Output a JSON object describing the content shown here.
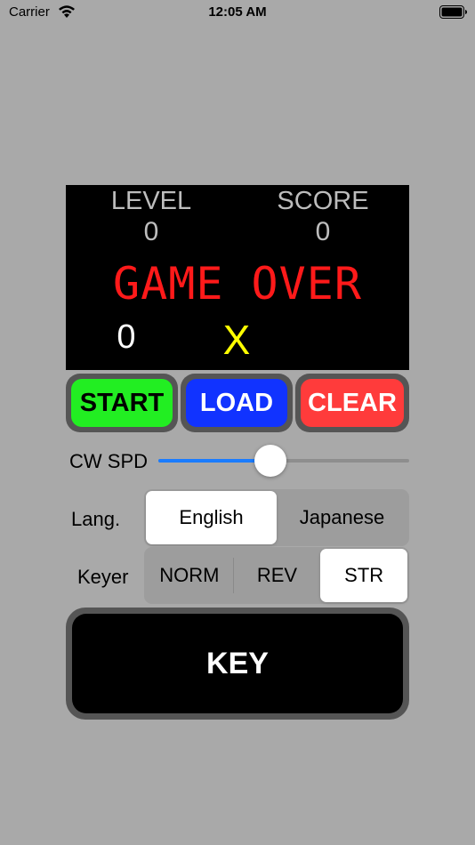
{
  "status_bar": {
    "carrier": "Carrier",
    "time": "12:05 AM"
  },
  "display": {
    "level_label": "LEVEL",
    "level_value": "0",
    "score_label": "SCORE",
    "score_value": "0",
    "message": "GAME OVER",
    "count": "0",
    "character": "X",
    "message_color": "#ff1a1a",
    "character_color": "#ffff00"
  },
  "buttons": {
    "start": "START",
    "load": "LOAD",
    "clear": "CLEAR",
    "start_color": "#22ee22",
    "load_color": "#1133ff",
    "clear_color": "#ff3b3b"
  },
  "cw_speed": {
    "label": "CW SPD",
    "value_fraction": 0.44,
    "accent": "#1a7cff"
  },
  "language": {
    "label": "Lang.",
    "options": [
      "English",
      "Japanese"
    ],
    "selected": "English"
  },
  "keyer": {
    "label": "Keyer",
    "options": [
      "NORM",
      "REV",
      "STR"
    ],
    "selected": "STR"
  },
  "key_button": {
    "label": "KEY"
  }
}
